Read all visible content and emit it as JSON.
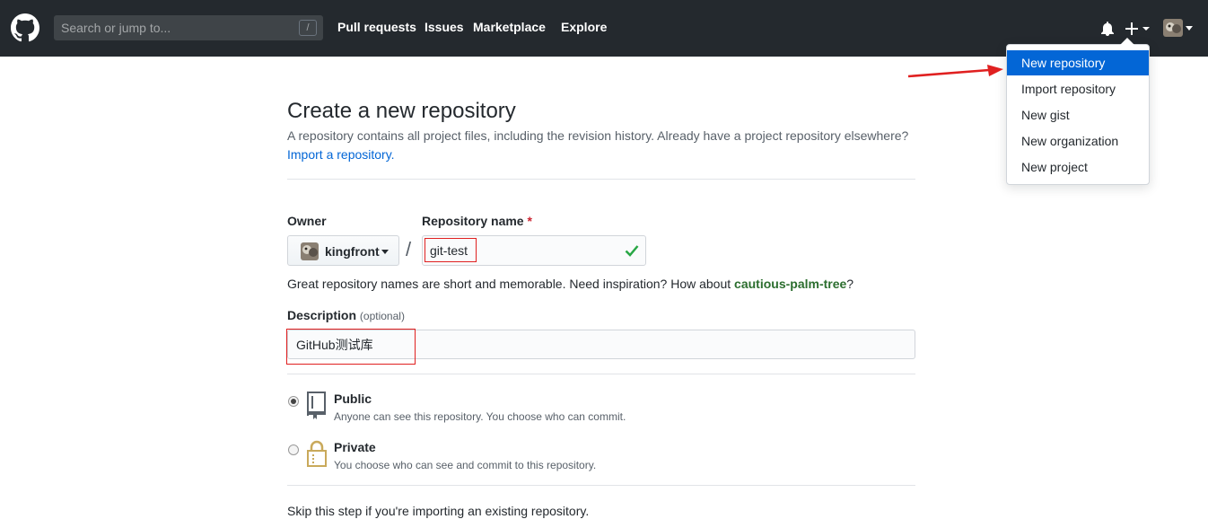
{
  "header": {
    "search_placeholder": "Search or jump to...",
    "search_shortcut": "/",
    "nav": [
      "Pull requests",
      "Issues",
      "Marketplace",
      "Explore"
    ],
    "icons": [
      "github-logo-icon",
      "bell-icon",
      "plus-icon",
      "avatar"
    ]
  },
  "dropdown": {
    "items": [
      "New repository",
      "Import repository",
      "New gist",
      "New organization",
      "New project"
    ],
    "active_index": 0
  },
  "page": {
    "title": "Create a new repository",
    "subtitle": "A repository contains all project files, including the revision history. Already have a project repository elsewhere?",
    "import_link": "Import a repository."
  },
  "form": {
    "owner_label": "Owner",
    "owner_name": "kingfront",
    "repo_label": "Repository name",
    "required_mark": "*",
    "separator": "/",
    "repo_value": "git-test",
    "hint_prefix": "Great repository names are short and memorable. Need inspiration? How about ",
    "hint_suggestion": "cautious-palm-tree",
    "hint_suffix": "?",
    "desc_label": "Description",
    "desc_optional": "(optional)",
    "desc_value": "GitHub测试库",
    "visibility": [
      {
        "title": "Public",
        "desc": "Anyone can see this repository. You choose who can commit.",
        "checked": true,
        "icon": "repo-book-icon"
      },
      {
        "title": "Private",
        "desc": "You choose who can see and commit to this repository.",
        "checked": false,
        "icon": "lock-icon"
      }
    ],
    "skip_text": "Skip this step if you're importing an existing repository."
  },
  "colors": {
    "header_bg": "#24292e",
    "accent": "#0366d6",
    "annotation_red": "#e02020",
    "success": "#28a745"
  }
}
